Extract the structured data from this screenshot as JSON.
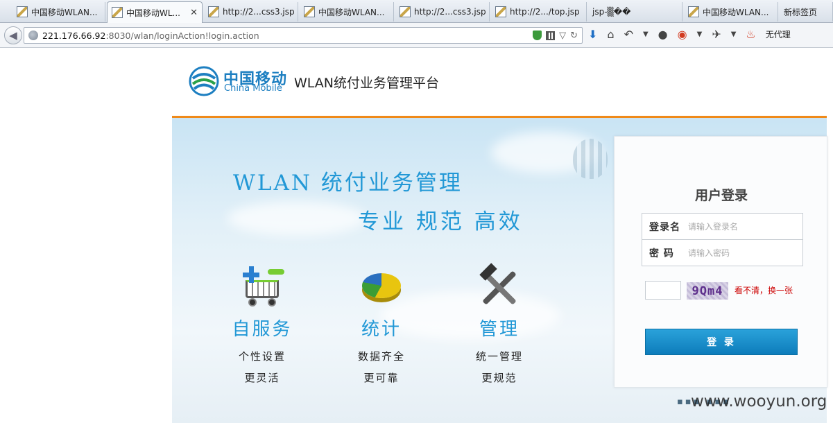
{
  "browser": {
    "tabs": [
      {
        "title": "中国移动WLAN...",
        "active": false
      },
      {
        "title": "中国移动WL...",
        "active": true
      },
      {
        "title": "http://2...css3.jsp",
        "active": false
      },
      {
        "title": "中国移动WLAN...",
        "active": false
      },
      {
        "title": "http://2...css3.jsp",
        "active": false
      },
      {
        "title": "http://2.../top.jsp",
        "active": false
      },
      {
        "title": "jsp-▒��",
        "active": false
      },
      {
        "title": "中国移动WLAN...",
        "active": false
      },
      {
        "title": "新标签页",
        "active": false
      }
    ],
    "url_host": "221.176.66.92",
    "url_path": ":8030/wlan/loginAction!login.action",
    "toolbar_label": "无代理"
  },
  "header": {
    "brand_cn": "中国移动",
    "brand_en": "China Mobile",
    "site_title": "WLAN统付业务管理平台"
  },
  "banner": {
    "slogan1": "WLAN 统付业务管理",
    "slogan2": "专业 规范 高效",
    "features": [
      {
        "title": "自服务",
        "line1": "个性设置",
        "line2": "更灵活"
      },
      {
        "title": "统计",
        "line1": "数据齐全",
        "line2": "更可靠"
      },
      {
        "title": "管理",
        "line1": "统一管理",
        "line2": "更规范"
      }
    ]
  },
  "login": {
    "title": "用户登录",
    "username_label": "登录名",
    "username_placeholder": "请输入登录名",
    "password_label": "密 码",
    "password_placeholder": "请输入密码",
    "captcha_text": "9Qm4",
    "captcha_refresh": "看不清，换一张",
    "submit_label": "登 录"
  },
  "watermark": "www.wooyun.org"
}
